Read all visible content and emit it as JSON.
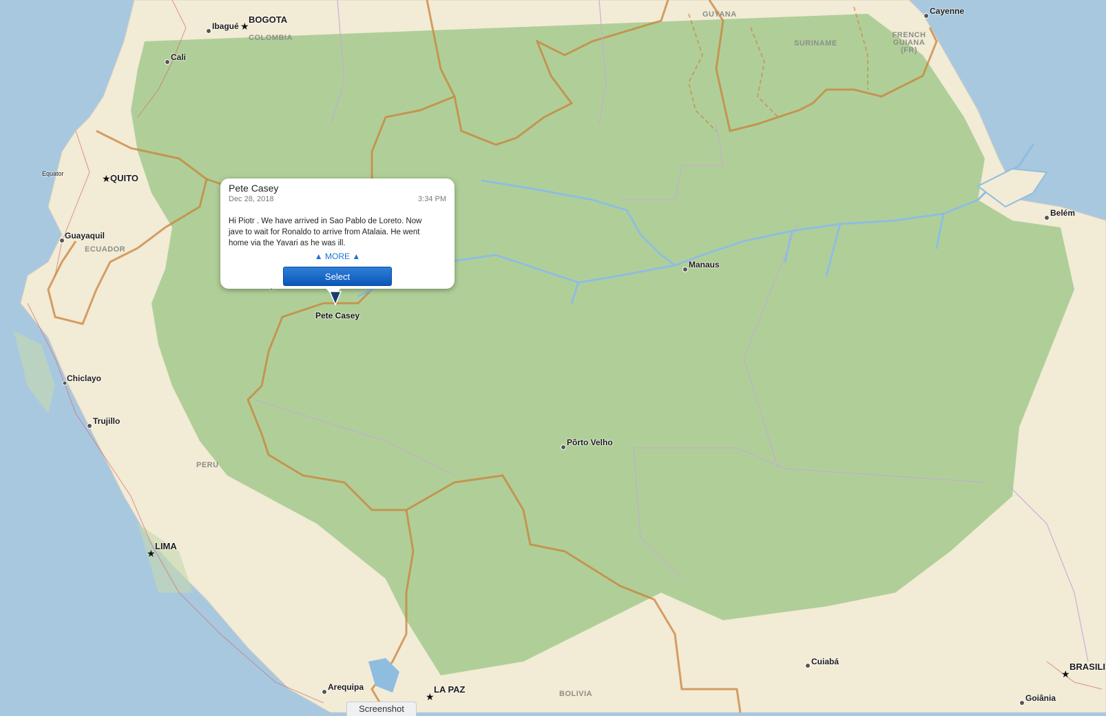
{
  "map": {
    "colors": {
      "ocean": "#a8c8e0",
      "land": "#f2ebd6",
      "forest": "#b0cf98",
      "border": "#c9813a",
      "river": "#9ac3e0"
    },
    "capitals": [
      "BOGOTA",
      "QUITO",
      "LIMA",
      "LA PAZ",
      "BRASILI"
    ],
    "cities": [
      "Ibagué",
      "Cali",
      "Guayaquil",
      "Chiclayo",
      "Trujillo",
      "Arequipa",
      "Manaus",
      "Pôrto Velho",
      "Belém",
      "Cayenne",
      "Cuiabá",
      "Goiânia"
    ],
    "countries": [
      "COLOMBIA",
      "ECUADOR",
      "PERU",
      "BOLIVIA",
      "GUYANA",
      "SURINAME",
      "FRENCH GUIANA (FR)"
    ],
    "features": [
      "Equator"
    ]
  },
  "callout": {
    "name": "Pete Casey",
    "date": "Dec 28, 2018",
    "time": "3:34 PM",
    "message": "Hi Piotr . We have arrived in Sao Pablo de Loreto. Now jave to wait for Ronaldo to arrive from Atalaia. He went home via the Yavari as he was ill.",
    "more_label": "▲ MORE ▲",
    "select_label": "Select"
  },
  "marker": {
    "label": "Pete Casey"
  },
  "screenshot_tab": "Screenshot"
}
